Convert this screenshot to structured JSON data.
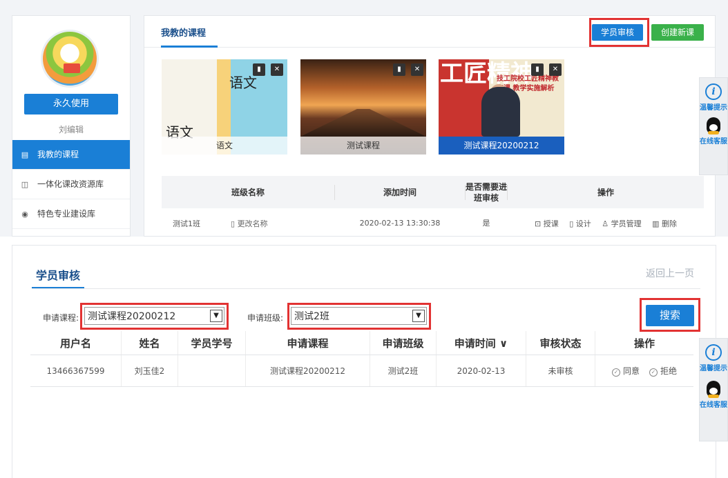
{
  "sidebar": {
    "forever_button": "永久使用",
    "editor_name": "刘编辑",
    "items": [
      {
        "label": "我教的课程",
        "icon": "document-icon"
      },
      {
        "label": "一体化课改资源库",
        "icon": "book-icon"
      },
      {
        "label": "特色专业建设库",
        "icon": "star-circle-icon"
      }
    ]
  },
  "courses_panel": {
    "title": "我教的课程",
    "audit_button": "学员审核",
    "create_button": "创建新课",
    "courses": [
      {
        "caption": "语文",
        "cover_text_1": "语文",
        "cover_text_2": "语文"
      },
      {
        "caption": "测试课程"
      },
      {
        "caption": "测试课程20200212",
        "cover_title": "工匠精神",
        "cover_sub": "技工院校工匠精神教育课 教学实施解析"
      }
    ],
    "class_table": {
      "headers": [
        "班级名称",
        "添加时间",
        "是否需要进班审核",
        "操作"
      ],
      "rows": [
        {
          "name": "测试1班",
          "rename": "更改名称",
          "time": "2020-02-13 13:30:38",
          "need_audit": "是",
          "ops": [
            "授课",
            "设计",
            "学员管理",
            "删除"
          ]
        }
      ]
    }
  },
  "float_panel": {
    "tip_label": "温馨提示",
    "service_label": "在线客服"
  },
  "audit": {
    "title": "学员审核",
    "back_link": "返回上一页",
    "course_label": "申请课程:",
    "course_value": "测试课程20200212",
    "class_label": "申请班级:",
    "class_value": "测试2班",
    "search_button": "搜索",
    "headers": [
      "用户名",
      "姓名",
      "学员学号",
      "申请课程",
      "申请班级",
      "申请时间 ∨",
      "审核状态",
      "操作"
    ],
    "rows": [
      {
        "username": "13466367599",
        "name": "刘玉佳2",
        "student_no": "",
        "course": "测试课程20200212",
        "class": "测试2班",
        "date": "2020-02-13",
        "status": "未审核",
        "agree": "同意",
        "reject": "拒绝"
      }
    ]
  },
  "colors": {
    "primary": "#1a7fd6",
    "green": "#3ab14a",
    "highlight": "#e23232"
  }
}
